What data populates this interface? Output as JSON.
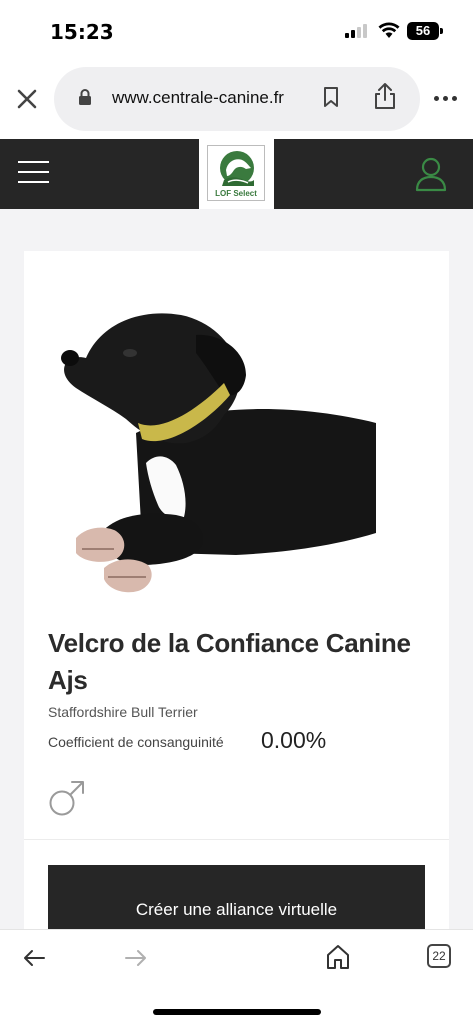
{
  "status_bar": {
    "time": "15:23",
    "battery": "56"
  },
  "browser": {
    "url": "www.centrale-canine.fr",
    "tab_count": "22"
  },
  "site_header": {
    "logo_caption": "LOF Select"
  },
  "dog": {
    "name": "Velcro de la Confiance Canine Ajs",
    "breed": "Staffordshire Bull Terrier",
    "coefficient_label": "Coefficient de consanguinité",
    "coefficient_value": "0.00%",
    "sex_icon": "male-symbol-icon"
  },
  "actions": {
    "alliance_button": "Créer une alliance virtuelle"
  },
  "colors": {
    "header_bg": "#262626",
    "brand_green": "#3a7a3e",
    "content_bg": "#f3f3f5"
  }
}
